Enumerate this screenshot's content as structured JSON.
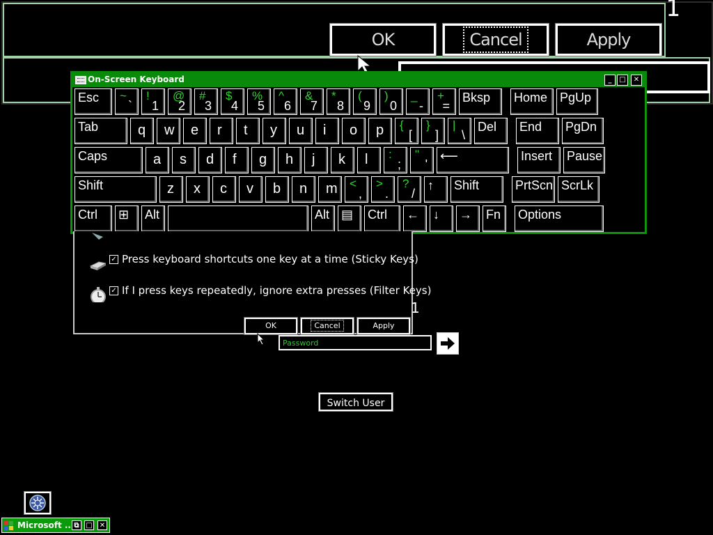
{
  "magnifier": {
    "corner_number": "1",
    "ok_label": "OK",
    "cancel_label": "Cancel",
    "apply_label": "Apply"
  },
  "osk": {
    "title": "On-Screen Keyboard",
    "minimize": "_",
    "maximize": "□",
    "close": "✕",
    "accent_color": "#0a9a0a",
    "rows": [
      [
        {
          "id": "esc",
          "label": "Esc"
        },
        {
          "id": "backtick",
          "shift": "~",
          "lower": "`"
        },
        {
          "id": "1",
          "shift": "!",
          "lower": "1"
        },
        {
          "id": "2",
          "shift": "@",
          "lower": "2"
        },
        {
          "id": "3",
          "shift": "#",
          "lower": "3"
        },
        {
          "id": "4",
          "shift": "$",
          "lower": "4"
        },
        {
          "id": "5",
          "shift": "%",
          "lower": "5"
        },
        {
          "id": "6",
          "shift": "^",
          "lower": "6"
        },
        {
          "id": "7",
          "shift": "&",
          "lower": "7"
        },
        {
          "id": "8",
          "shift": "*",
          "lower": "8"
        },
        {
          "id": "9",
          "shift": "(",
          "lower": "9"
        },
        {
          "id": "0",
          "shift": ")",
          "lower": "0"
        },
        {
          "id": "minus",
          "shift": "_",
          "lower": "-"
        },
        {
          "id": "equals",
          "shift": "+",
          "lower": "="
        },
        {
          "id": "bksp",
          "label": "Bksp"
        },
        {
          "id": "home",
          "label": "Home"
        },
        {
          "id": "pgup",
          "label": "PgUp"
        }
      ],
      [
        {
          "id": "tab",
          "label": "Tab"
        },
        {
          "id": "q",
          "char": "q"
        },
        {
          "id": "w",
          "char": "w"
        },
        {
          "id": "e",
          "char": "e"
        },
        {
          "id": "r",
          "char": "r"
        },
        {
          "id": "t",
          "char": "t"
        },
        {
          "id": "y",
          "char": "y"
        },
        {
          "id": "u",
          "char": "u"
        },
        {
          "id": "i",
          "char": "i"
        },
        {
          "id": "o",
          "char": "o"
        },
        {
          "id": "p",
          "char": "p"
        },
        {
          "id": "lbracket",
          "shift": "{",
          "lower": "["
        },
        {
          "id": "rbracket",
          "shift": "}",
          "lower": "]"
        },
        {
          "id": "backslash",
          "shift": "|",
          "lower": "\\"
        },
        {
          "id": "del",
          "label": "Del"
        },
        {
          "id": "end",
          "label": "End"
        },
        {
          "id": "pgdn",
          "label": "PgDn"
        }
      ],
      [
        {
          "id": "caps",
          "label": "Caps"
        },
        {
          "id": "a",
          "char": "a"
        },
        {
          "id": "s",
          "char": "s"
        },
        {
          "id": "d",
          "char": "d"
        },
        {
          "id": "f",
          "char": "f"
        },
        {
          "id": "g",
          "char": "g"
        },
        {
          "id": "h",
          "char": "h"
        },
        {
          "id": "j",
          "char": "j"
        },
        {
          "id": "k",
          "char": "k"
        },
        {
          "id": "l",
          "char": "l"
        },
        {
          "id": "semicolon",
          "shift": ":",
          "lower": ";"
        },
        {
          "id": "quote",
          "shift": "\"",
          "lower": "'"
        },
        {
          "id": "enter",
          "label": "⟵"
        },
        {
          "id": "insert",
          "label": "Insert"
        },
        {
          "id": "pause",
          "label": "Pause"
        }
      ],
      [
        {
          "id": "lshift",
          "label": "Shift"
        },
        {
          "id": "z",
          "char": "z"
        },
        {
          "id": "x",
          "char": "x"
        },
        {
          "id": "c",
          "char": "c"
        },
        {
          "id": "v",
          "char": "v"
        },
        {
          "id": "b",
          "char": "b"
        },
        {
          "id": "n",
          "char": "n"
        },
        {
          "id": "m",
          "char": "m"
        },
        {
          "id": "comma",
          "shift": "<",
          "lower": ","
        },
        {
          "id": "period",
          "shift": ">",
          "lower": "."
        },
        {
          "id": "slash",
          "shift": "?",
          "lower": "/"
        },
        {
          "id": "up",
          "label": "↑"
        },
        {
          "id": "rshift",
          "label": "Shift"
        },
        {
          "id": "prtscn",
          "label": "PrtScn"
        },
        {
          "id": "scrlk",
          "label": "ScrLk"
        }
      ],
      [
        {
          "id": "lctrl",
          "label": "Ctrl"
        },
        {
          "id": "win",
          "label": "⊞"
        },
        {
          "id": "lalt",
          "label": "Alt"
        },
        {
          "id": "space",
          "label": ""
        },
        {
          "id": "ralt",
          "label": "Alt"
        },
        {
          "id": "menu",
          "label": "▤"
        },
        {
          "id": "rctrl",
          "label": "Ctrl"
        },
        {
          "id": "left",
          "label": "←"
        },
        {
          "id": "down",
          "label": "↓"
        },
        {
          "id": "right",
          "label": "→"
        },
        {
          "id": "fn",
          "label": "Fn"
        },
        {
          "id": "options",
          "label": "Options"
        }
      ]
    ]
  },
  "dialog": {
    "options": [
      {
        "label": "Press keyboard shortcuts one key at a time (Sticky Keys)",
        "checked": true,
        "icon": "sticky-keys-icon"
      },
      {
        "label": "If I press keys repeatedly, ignore extra presses (Filter Keys)",
        "checked": true,
        "icon": "filter-keys-icon"
      }
    ],
    "ok_label": "OK",
    "cancel_label": "Cancel",
    "apply_label": "Apply",
    "side_number": "1"
  },
  "logon": {
    "password_placeholder": "Password",
    "switch_user_label": "Switch User"
  },
  "taskbar": {
    "title": "Microsoft ..."
  }
}
